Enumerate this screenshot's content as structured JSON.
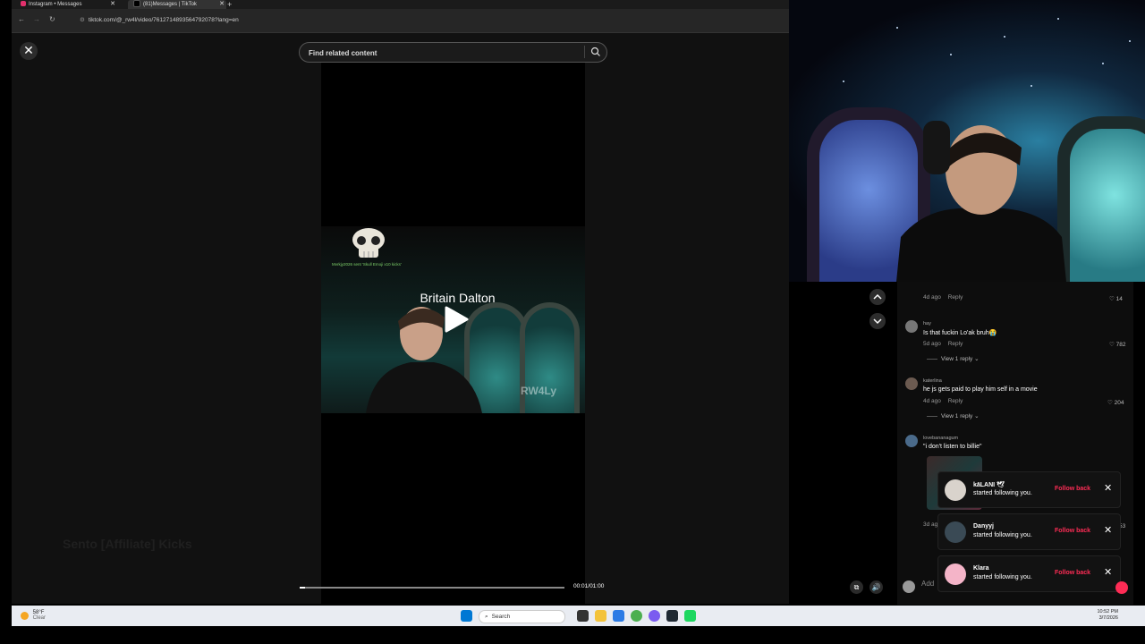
{
  "browser": {
    "tabs": [
      {
        "label": "Instagram • Messages"
      },
      {
        "label": "(81)Messages | TikTok"
      }
    ],
    "new_tab": "+",
    "url": "tiktok.com/@_rw4l/video/7612714893564792078?lang=en"
  },
  "search": {
    "placeholder": "Find related content"
  },
  "video": {
    "title": "Britain Dalton",
    "skull_caption": "Mvrkjy2026 sent 'Skull Emoji x10 kicks'",
    "watermark": "RW4Ly",
    "time": "00:01/01:00",
    "progress": 0.02,
    "background_text": "Sento [Affiliate] Kicks"
  },
  "comments": [
    {
      "meta_time": "4d ago",
      "reply": "Reply",
      "likes": "14"
    },
    {
      "user": "hay",
      "text": "Is that fuckin Lo'ak bruh😭",
      "meta_time": "5d ago",
      "reply": "Reply",
      "likes": "782",
      "view_reply": "View 1 reply"
    },
    {
      "user": "katerlina",
      "text": "he js gets paid to play him self in a movie",
      "meta_time": "4d ago",
      "reply": "Reply",
      "likes": "204",
      "view_reply": "View 1 reply"
    },
    {
      "user": "lovebananagum",
      "text": "\"i don't listen to billie\"",
      "meta_time": "3d ag",
      "likes": "53"
    }
  ],
  "comment_input": {
    "placeholder": "Add"
  },
  "notifications": [
    {
      "name": "kāLANI 🕊",
      "message": "started following you.",
      "action": "Follow back"
    },
    {
      "name": "Danyyj",
      "message": "started following you.",
      "action": "Follow back"
    },
    {
      "name": "Klara",
      "message": "started following you.",
      "action": "Follow back"
    }
  ],
  "taskbar": {
    "weather_temp": "58°F",
    "weather_desc": "Clear",
    "search_label": "Search",
    "time": "10:52 PM",
    "date": "3/7/2026"
  },
  "colors": {
    "accent": "#fe2c55",
    "bg": "#111111"
  }
}
